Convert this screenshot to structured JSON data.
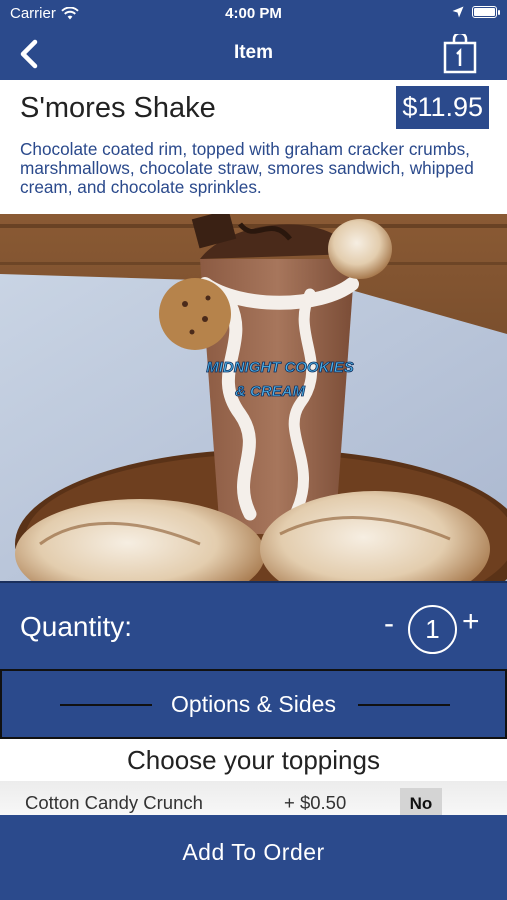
{
  "status_bar": {
    "carrier": "Carrier",
    "time": "4:00 PM"
  },
  "nav": {
    "title": "Item"
  },
  "item": {
    "name": "S'mores Shake",
    "price": "$11.95",
    "description": "Chocolate coated rim, topped with graham cracker crumbs, marshmallows, chocolate straw, smores sandwich, whipped cream, and chocolate sprinkles."
  },
  "photo": {
    "cup_text_line1": "MIDNIGHT COOKIES",
    "cup_text_line2": "& CREAM"
  },
  "quantity": {
    "label": "Quantity:",
    "minus": "-",
    "value": "1",
    "plus": "+"
  },
  "options": {
    "label": "Options & Sides"
  },
  "toppings": {
    "title": "Choose your toppings",
    "items": [
      {
        "name": "Cotton Candy Crunch",
        "price": "+ $0.50",
        "selection": "No"
      }
    ]
  },
  "add_button": {
    "label": "Add To Order"
  },
  "colors": {
    "brand_blue": "#2b4a8c",
    "description_text": "#2b4a8c"
  }
}
